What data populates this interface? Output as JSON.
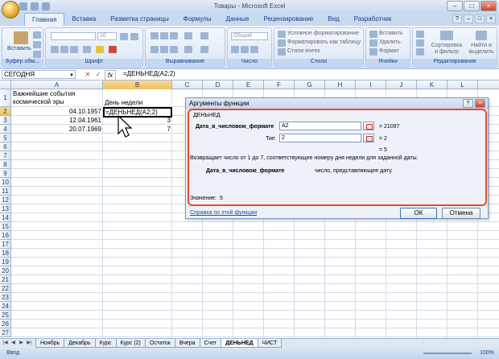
{
  "window": {
    "title": "Товары - Microsoft Excel",
    "minimize": "–",
    "maximize": "□",
    "close": "×"
  },
  "tabs": [
    "Главная",
    "Вставка",
    "Разметка страницы",
    "Формулы",
    "Данные",
    "Рецензирование",
    "Вид",
    "Разработчик"
  ],
  "ribbon": {
    "groups": [
      "Буфер обм...",
      "Шрифт",
      "Выравнивание",
      "Число",
      "Стили",
      "Ячейки",
      "Редактирование"
    ],
    "paste": "Вставить",
    "font_size": "10",
    "number_format": "Общий",
    "styles": [
      "Условное форматирование",
      "Форматировать как таблицу",
      "Стили ячеек"
    ],
    "cells": [
      "Вставить",
      "Удалить",
      "Формат"
    ],
    "edit": [
      "Сортировка и фильтр",
      "Найти и выделить"
    ]
  },
  "formula_bar": {
    "name_box": "СЕГОДНЯ",
    "cancel": "✕",
    "enter": "✓",
    "fx": "fx",
    "formula": "=ДЕНЬНЕД(A2;2)"
  },
  "columns": [
    "A",
    "B",
    "C",
    "D",
    "E",
    "F",
    "G",
    "H",
    "I",
    "J",
    "K",
    "L"
  ],
  "rows": [
    "1",
    "2",
    "3",
    "4",
    "5",
    "6",
    "7",
    "8",
    "9",
    "10",
    "11",
    "12",
    "13",
    "14",
    "15",
    "16",
    "17",
    "18",
    "19",
    "20",
    "21",
    "22",
    "23",
    "24",
    "25",
    "26",
    "27"
  ],
  "cells": {
    "A1": "Важнейшие события космической эры",
    "B1": "День недели",
    "A2": "04.10.1957",
    "B2": "=ДЕНЬНЕД(A2;2)",
    "A3": "12.04.1961",
    "B3": "3",
    "A4": "20.07.1969",
    "B4": "7"
  },
  "dialog": {
    "title": "Аргументы функции",
    "help": "?",
    "close": "×",
    "func_name": "ДЕНЬНЕД",
    "arg1_label": "Дата_в_числовом_формате",
    "arg1_value": "A2",
    "arg1_result": "=  21097",
    "arg2_label": "Тип",
    "arg2_value": "2",
    "arg2_result": "=  2",
    "total_result": "=  5",
    "description": "Возвращает число от 1 до 7, соответствующее номеру дня недели для заданной даты.",
    "arg_desc_label": "Дата_в_числовом_формате",
    "arg_desc_text": "число, представляющее дату.",
    "value_label": "Значение:",
    "value": "5",
    "help_link": "Справка по этой функции",
    "ok": "ОК",
    "cancel": "Отмена"
  },
  "sheet_tabs": [
    "Ноябрь",
    "Декабрь",
    "Курс",
    "Курс (2)",
    "Остаток",
    "Вчера",
    "Счет",
    "ДЕНЬНЕД",
    "ЧИСТ"
  ],
  "active_sheet": "ДЕНЬНЕД",
  "status": {
    "ready": "Ввод",
    "zoom": "100%"
  }
}
